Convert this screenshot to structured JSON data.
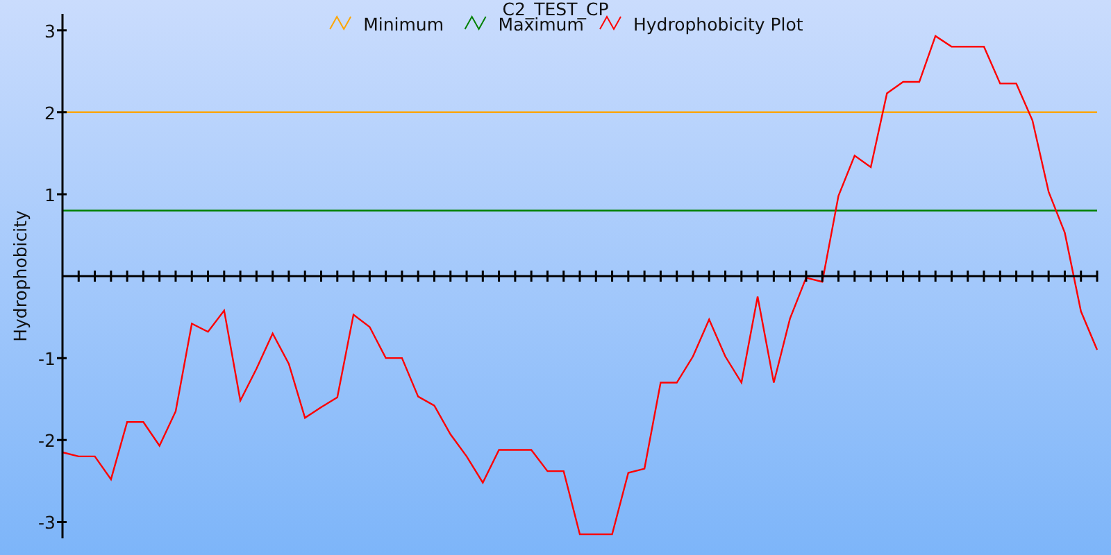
{
  "chart": {
    "chart_data": {
      "type": "line",
      "title": "C2_TEST_CP",
      "legend": true,
      "ylabel": "Hydrophobicity",
      "ylim": [
        -3.2,
        3.2
      ],
      "yticks": [
        -3,
        -2,
        -1,
        1,
        2,
        3
      ],
      "series": [
        {
          "name": "Minimum",
          "color": "#ffa500",
          "values": [
            2,
            2,
            2,
            2,
            2,
            2,
            2,
            2,
            2,
            2,
            2,
            2,
            2,
            2,
            2,
            2,
            2,
            2,
            2,
            2,
            2,
            2,
            2,
            2,
            2,
            2,
            2,
            2,
            2,
            2,
            2,
            2,
            2,
            2,
            2,
            2,
            2,
            2,
            2,
            2,
            2,
            2,
            2,
            2,
            2,
            2,
            2,
            2,
            2,
            2,
            2,
            2,
            2,
            2,
            2,
            2,
            2,
            2,
            2,
            2,
            2,
            2,
            2,
            2,
            2
          ]
        },
        {
          "name": "Maximum",
          "color": "#008000",
          "values": [
            0.8,
            0.8,
            0.8,
            0.8,
            0.8,
            0.8,
            0.8,
            0.8,
            0.8,
            0.8,
            0.8,
            0.8,
            0.8,
            0.8,
            0.8,
            0.8,
            0.8,
            0.8,
            0.8,
            0.8,
            0.8,
            0.8,
            0.8,
            0.8,
            0.8,
            0.8,
            0.8,
            0.8,
            0.8,
            0.8,
            0.8,
            0.8,
            0.8,
            0.8,
            0.8,
            0.8,
            0.8,
            0.8,
            0.8,
            0.8,
            0.8,
            0.8,
            0.8,
            0.8,
            0.8,
            0.8,
            0.8,
            0.8,
            0.8,
            0.8,
            0.8,
            0.8,
            0.8,
            0.8,
            0.8,
            0.8,
            0.8,
            0.8,
            0.8,
            0.8,
            0.8,
            0.8,
            0.8,
            0.8,
            0.8
          ]
        },
        {
          "name": "Hydrophobicity Plot",
          "color": "#ff0000",
          "values": [
            -2.15,
            -2.2,
            -2.2,
            -2.48,
            -1.78,
            -1.78,
            -2.07,
            -1.65,
            -0.58,
            -0.68,
            -0.42,
            -1.52,
            -1.13,
            -0.7,
            -1.07,
            -1.73,
            -1.6,
            -1.48,
            -0.47,
            -0.62,
            -1.0,
            -1.0,
            -1.47,
            -1.58,
            -1.93,
            -2.2,
            -2.52,
            -2.12,
            -2.12,
            -2.12,
            -2.38,
            -2.38,
            -3.15,
            -3.15,
            -3.15,
            -2.4,
            -2.35,
            -1.3,
            -1.3,
            -0.98,
            -0.53,
            -0.98,
            -1.3,
            -0.25,
            -1.3,
            -0.52,
            -0.02,
            -0.07,
            0.98,
            1.47,
            1.33,
            2.23,
            2.37,
            2.37,
            2.93,
            2.8,
            2.8,
            2.8,
            2.35,
            2.35,
            1.9,
            1.03,
            0.53,
            -0.43,
            -0.9
          ]
        }
      ]
    }
  }
}
